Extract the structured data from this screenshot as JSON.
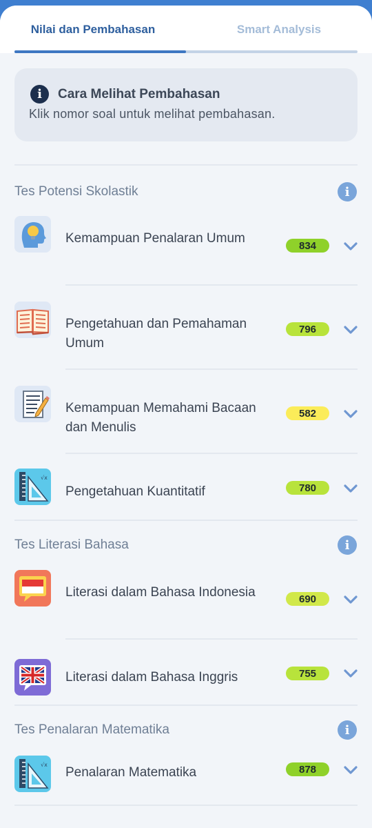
{
  "tabs": [
    {
      "label": "Nilai dan Pembahasan",
      "active": true
    },
    {
      "label": "Smart Analysis",
      "active": false
    }
  ],
  "info_card": {
    "title": "Cara Melihat Pembahasan",
    "description": "Klik nomor soal untuk melihat pembahasan.",
    "icon": "info-icon"
  },
  "sections": [
    {
      "title": "Tes Potensi Skolastik",
      "items": [
        {
          "label": "Kemampuan Penalaran Umum",
          "score": "834",
          "score_color": "#8fd12a",
          "icon": "head-lightbulb-icon"
        },
        {
          "label": "Pengetahuan dan Pemahaman Umum",
          "score": "796",
          "score_color": "#b8e33b",
          "icon": "open-book-icon"
        },
        {
          "label": "Kemampuan Memahami Bacaan dan Menulis",
          "score": "582",
          "score_color": "#fbec59",
          "icon": "document-pencil-icon"
        },
        {
          "label": "Pengetahuan Kuantitatif",
          "score": "780",
          "score_color": "#b8e33b",
          "icon": "ruler-triangle-icon"
        }
      ]
    },
    {
      "title": "Tes Literasi Bahasa",
      "items": [
        {
          "label": "Literasi dalam Bahasa Indonesia",
          "score": "690",
          "score_color": "#d1e84a",
          "icon": "indonesia-flag-chat-icon"
        },
        {
          "label": "Literasi dalam Bahasa Inggris",
          "score": "755",
          "score_color": "#b8e33b",
          "icon": "uk-flag-chat-icon"
        }
      ]
    },
    {
      "title": "Tes Penalaran Matematika",
      "items": [
        {
          "label": "Penalaran Matematika",
          "score": "878",
          "score_color": "#8fd12a",
          "icon": "ruler-triangle-icon"
        }
      ]
    }
  ],
  "colors": {
    "header_bar": "#3f7fd0",
    "tab_active": "#2e5f9e",
    "tab_inactive": "#a4bcd8",
    "chevron": "#6f97d1",
    "section_info_icon": "#7aa5da"
  }
}
